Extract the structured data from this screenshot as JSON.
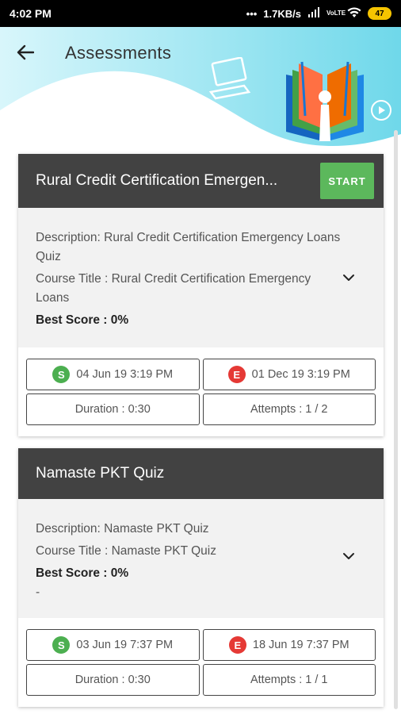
{
  "status_bar": {
    "time": "4:02 PM",
    "network_speed": "1.7KB/s",
    "network_type": "VoLTE",
    "battery": "47"
  },
  "header": {
    "title": "Assessments"
  },
  "colors": {
    "card_header": "#424242",
    "start_button": "#5cb85c",
    "start_badge": "#4caf50",
    "end_badge": "#e53935"
  },
  "assessments": [
    {
      "title": "Rural Credit Certification Emergen...",
      "start_label": "START",
      "description": "Description: Rural Credit Certification Emergency Loans Quiz",
      "course_title": "Course Title : Rural Credit Certification Emergency Loans",
      "best_score": "Best Score : 0%",
      "start_badge": "S",
      "start_date": "04 Jun 19 3:19 PM",
      "end_badge": "E",
      "end_date": "01 Dec 19 3:19 PM",
      "duration": "Duration : 0:30",
      "attempts": "Attempts : 1 / 2"
    },
    {
      "title": "Namaste PKT Quiz",
      "description": "Description: Namaste PKT Quiz",
      "course_title": "Course Title : Namaste PKT Quiz",
      "best_score": "Best Score : 0%",
      "extra": "-",
      "start_badge": "S",
      "start_date": "03 Jun 19 7:37 PM",
      "end_badge": "E",
      "end_date": "18 Jun 19 7:37 PM",
      "duration": "Duration : 0:30",
      "attempts": "Attempts : 1 / 1"
    }
  ]
}
